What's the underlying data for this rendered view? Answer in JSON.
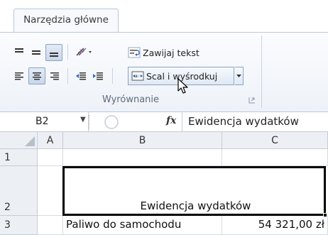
{
  "ribbon": {
    "tab_label": "Narzędzia główne",
    "group_label": "Wyrównanie",
    "wrap_text_label": "Zawijaj tekst",
    "merge_center_label": "Scal i wyśrodkuj",
    "icons": [
      "align-top-icon",
      "align-middle-icon",
      "align-bottom-icon",
      "orientation-icon",
      "align-left-icon",
      "align-center-icon",
      "align-right-icon",
      "decrease-indent-icon",
      "increase-indent-icon",
      "wrap-text-icon",
      "merge-center-icon",
      "dropdown-arrow-icon",
      "dialog-launcher-icon",
      "mouse-cursor-icon"
    ]
  },
  "formula_bar": {
    "name_box_value": "B2",
    "fx_label": "fx",
    "content": "Ewidencja wydatków"
  },
  "grid": {
    "columns": [
      "A",
      "B",
      "C"
    ],
    "rows": [
      "1",
      "2",
      "3"
    ],
    "b2": "Ewidencja wydatków",
    "b3": "Paliwo do samochodu",
    "c3": "54 321,00 zł"
  },
  "colors": {
    "ribbon_border": "#b9c9dc",
    "header_bg": "#eceff4",
    "selection": "#000000"
  }
}
